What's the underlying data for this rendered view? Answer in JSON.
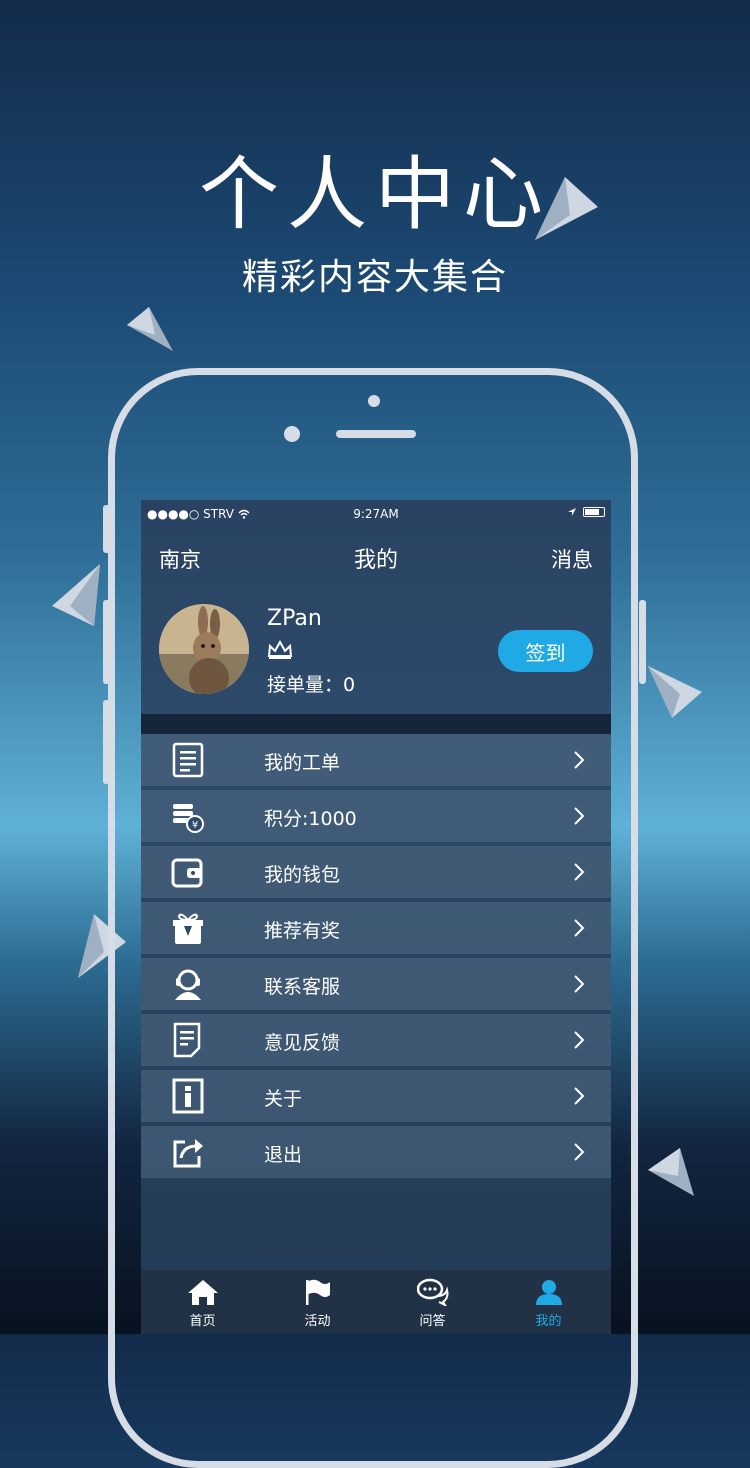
{
  "promo": {
    "title": "个人中心",
    "subtitle": "精彩内容大集合"
  },
  "status_bar": {
    "carrier": "●●●●○ STRV",
    "time": "9:27AM"
  },
  "nav": {
    "left": "南京",
    "title": "我的",
    "right": "消息"
  },
  "profile": {
    "username": "ZPan",
    "orders": "接单量：0",
    "sign_in": "签到"
  },
  "menu": [
    {
      "label": "我的工单",
      "icon": "document-list-icon"
    },
    {
      "label": "积分:1000",
      "icon": "coins-icon"
    },
    {
      "label": "我的钱包",
      "icon": "wallet-icon"
    },
    {
      "label": "推荐有奖",
      "icon": "gift-icon"
    },
    {
      "label": "联系客服",
      "icon": "headset-icon"
    },
    {
      "label": "意见反馈",
      "icon": "feedback-form-icon"
    },
    {
      "label": "关于",
      "icon": "info-icon"
    },
    {
      "label": "退出",
      "icon": "exit-share-icon"
    }
  ],
  "tabs": [
    {
      "label": "首页",
      "icon": "home-icon"
    },
    {
      "label": "活动",
      "icon": "flag-icon"
    },
    {
      "label": "问答",
      "icon": "chat-bubbles-icon"
    },
    {
      "label": "我的",
      "icon": "user-icon",
      "active": true
    }
  ],
  "colors": {
    "accent": "#1fa9e5",
    "active_tab": "#1fa9e5"
  }
}
